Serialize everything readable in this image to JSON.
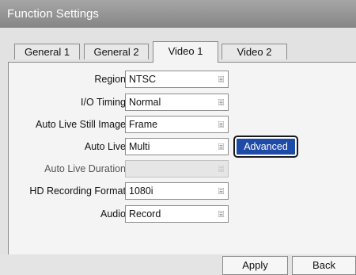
{
  "window": {
    "title": "Function Settings"
  },
  "tabs": [
    {
      "label": "General 1",
      "active": false
    },
    {
      "label": "General 2",
      "active": false
    },
    {
      "label": "Video 1",
      "active": true
    },
    {
      "label": "Video 2",
      "active": false
    }
  ],
  "settings": [
    {
      "label": "Region",
      "value": "NTSC",
      "enabled": true
    },
    {
      "label": "I/O Timing",
      "value": "Normal",
      "enabled": true
    },
    {
      "label": "Auto Live Still Image",
      "value": "Frame",
      "enabled": true
    },
    {
      "label": "Auto Live",
      "value": "Multi",
      "enabled": true
    },
    {
      "label": "Auto Live Duration",
      "value": "",
      "enabled": false
    },
    {
      "label": "HD Recording Format",
      "value": "1080i",
      "enabled": true
    },
    {
      "label": "Audio",
      "value": "Record",
      "enabled": true
    }
  ],
  "advanced_button": {
    "label": "Advanced",
    "color": "#1f4ba8"
  },
  "footer": {
    "apply_label": "Apply",
    "back_label": "Back"
  },
  "icons": {
    "dropdown": "menu-lines-icon"
  }
}
